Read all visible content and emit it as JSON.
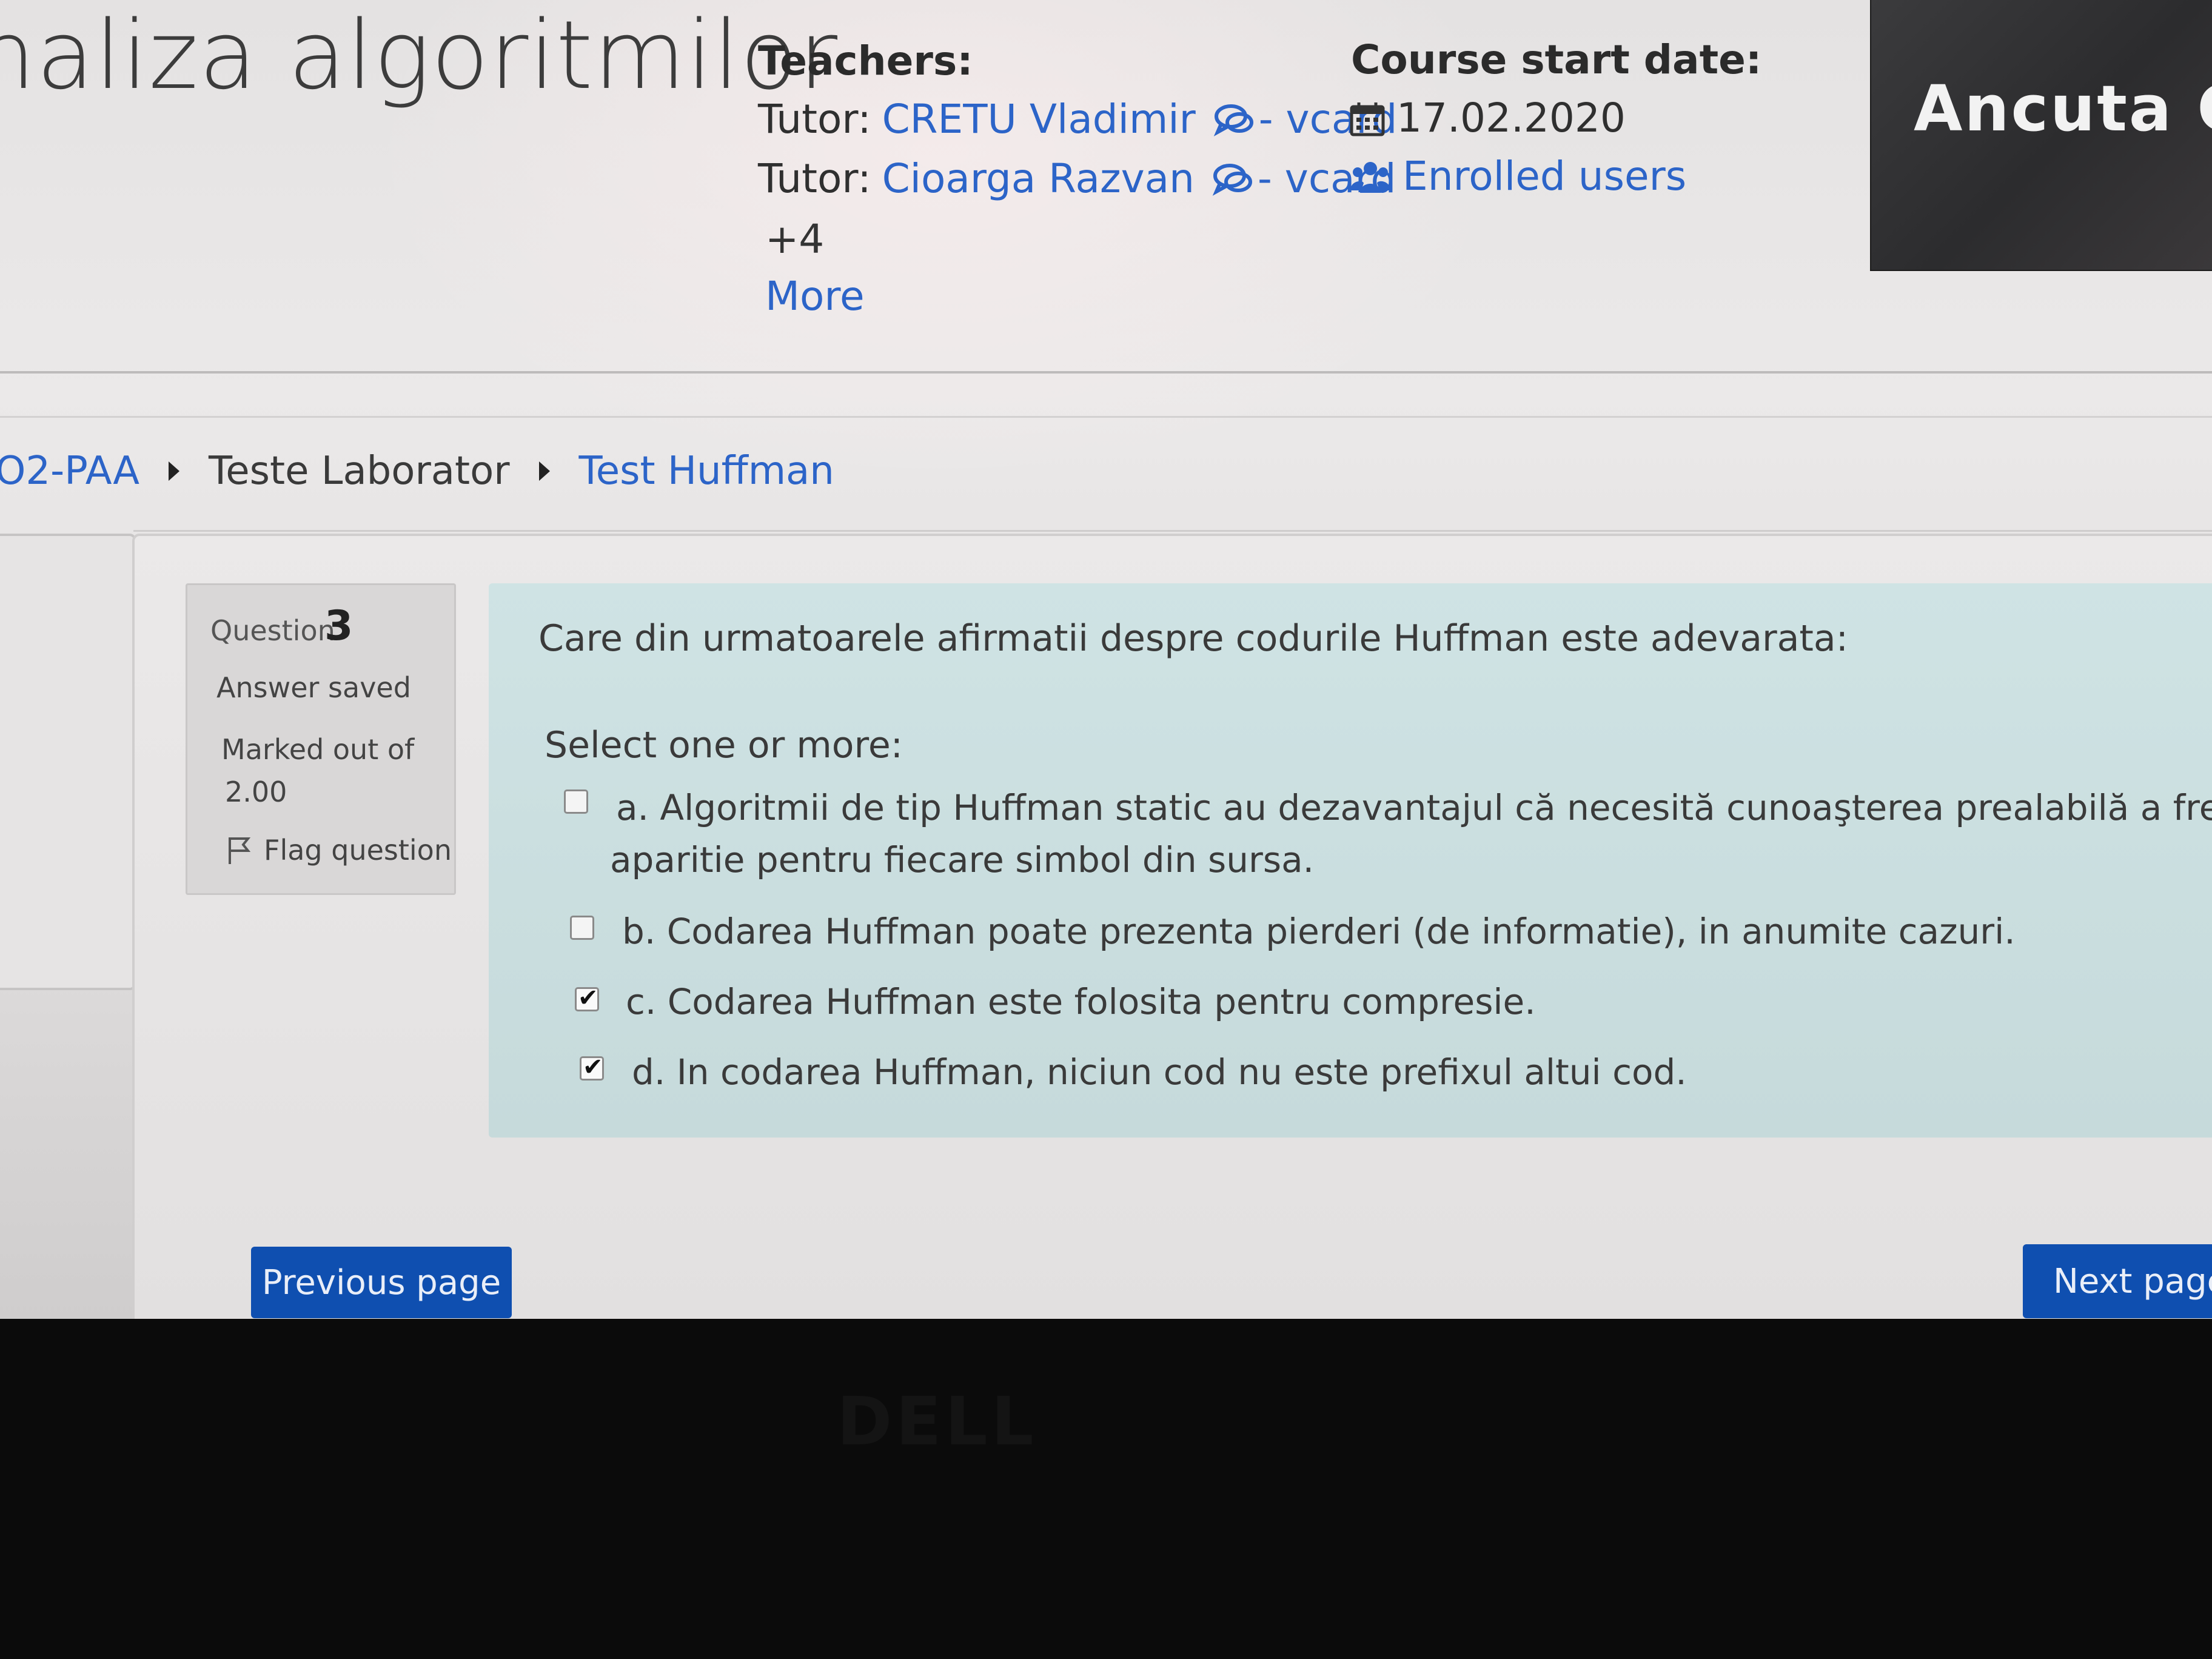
{
  "course": {
    "title": "naliza algoritmilor",
    "teachers_heading": "Teachers:",
    "tutors": [
      {
        "prefix": "Tutor: ",
        "name": "CRETU Vladimir",
        "vcard": " - vcard"
      },
      {
        "prefix": "Tutor: ",
        "name": "Cioarga Razvan",
        "vcard": " - vcard"
      }
    ],
    "more_count": "+4",
    "more_label": "More",
    "start_heading": "Course start date:",
    "start_date": "17.02.2020",
    "enrolled_label": "Enrolled users"
  },
  "video": {
    "participant_name": "Ancuta Ca"
  },
  "breadcrumb": [
    {
      "label": "O2-PAA",
      "link": true
    },
    {
      "label": "Teste Laborator",
      "link": false
    },
    {
      "label": "Test Huffman",
      "link": true
    }
  ],
  "question_info": {
    "label": "Question",
    "number": "3",
    "state": "Answer saved",
    "marked_line1": "Marked out of",
    "marked_line2": "2.00",
    "flag_label": "Flag question"
  },
  "question": {
    "text": "Care din urmatoarele afirmatii despre codurile Huffman este adevarata:",
    "prompt": "Select one or more:",
    "answers": [
      {
        "line1": "a. Algoritmii de tip Huffman static au dezavantajul că necesită cunoaşterea prealabilă a frecventelor de",
        "line2": "aparitie pentru fiecare simbol din sursa.",
        "checked": false
      },
      {
        "line1": "b. Codarea Huffman poate prezenta pierderi (de informatie), in anumite cazuri.",
        "checked": false
      },
      {
        "line1": "c. Codarea Huffman este folosita pentru compresie.",
        "checked": true
      },
      {
        "line1": "d. In codarea Huffman, niciun cod nu este prefixul altui cod.",
        "checked": true
      }
    ]
  },
  "navigation": {
    "previous_label": "Previous page",
    "next_label": "Next page"
  },
  "bezel": {
    "brand": "DELL"
  },
  "colors": {
    "link": "#2c64c8",
    "primary_button": "#0f4fb0",
    "question_bg": "#cfe3e4",
    "info_bg": "#d9d7d7"
  },
  "icons": [
    "chat-icon",
    "calendar-icon",
    "users-icon",
    "flag-icon",
    "caret-right-icon",
    "checkbox-icon"
  ]
}
